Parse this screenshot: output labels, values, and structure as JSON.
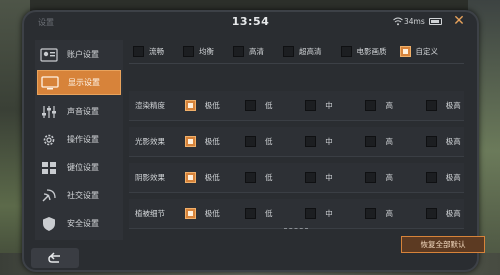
{
  "header": {
    "faded_title": "设置",
    "time": "13:54",
    "ping": "34ms",
    "close_glyph": "✕"
  },
  "sidebar": {
    "items": [
      {
        "label": "账户设置",
        "icon": "account-icon",
        "active": false
      },
      {
        "label": "显示设置",
        "icon": "display-icon",
        "active": true
      },
      {
        "label": "声音设置",
        "icon": "sound-sliders-icon",
        "active": false
      },
      {
        "label": "操作设置",
        "icon": "gear-icon",
        "active": false
      },
      {
        "label": "键位设置",
        "icon": "keyboard-icon",
        "active": false
      },
      {
        "label": "社交设置",
        "icon": "satellite-icon",
        "active": false
      },
      {
        "label": "安全设置",
        "icon": "shield-icon",
        "active": false
      }
    ]
  },
  "presets": {
    "options": [
      {
        "label": "流畅",
        "checked": false
      },
      {
        "label": "均衡",
        "checked": false
      },
      {
        "label": "高清",
        "checked": false
      },
      {
        "label": "超高清",
        "checked": false
      },
      {
        "label": "电影画质",
        "checked": false
      },
      {
        "label": "自定义",
        "checked": true
      }
    ]
  },
  "quality_rows": [
    {
      "label": "渲染精度",
      "options": [
        "极低",
        "低",
        "中",
        "高",
        "极高"
      ],
      "selected": 0
    },
    {
      "label": "光影效果",
      "options": [
        "极低",
        "低",
        "中",
        "高",
        "极高"
      ],
      "selected": 0
    },
    {
      "label": "阴影效果",
      "options": [
        "极低",
        "低",
        "中",
        "高",
        "极高"
      ],
      "selected": 0
    },
    {
      "label": "植被细节",
      "options": [
        "极低",
        "低",
        "中",
        "高",
        "极高"
      ],
      "selected": 0
    }
  ],
  "footer": {
    "restore_label": "恢复全部默认"
  },
  "colors": {
    "accent": "#d7833a",
    "panel": "#2d3035",
    "frame": "#2a2d31"
  }
}
